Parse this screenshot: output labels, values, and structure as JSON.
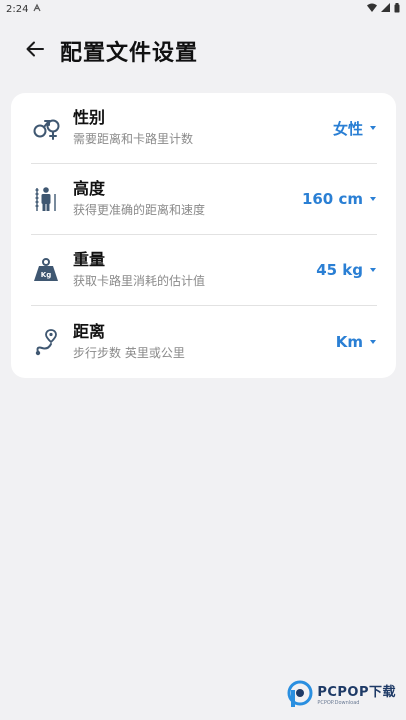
{
  "status_bar": {
    "time": "2:24"
  },
  "header": {
    "title": "配置文件设置"
  },
  "settings": [
    {
      "title": "性别",
      "subtitle": "需要距离和卡路里计数",
      "value": "女性",
      "icon": "gender-icon"
    },
    {
      "title": "高度",
      "subtitle": "获得更准确的距离和速度",
      "value": "160 cm",
      "icon": "height-icon"
    },
    {
      "title": "重量",
      "subtitle": "获取卡路里消耗的估计值",
      "value": "45 kg",
      "icon": "weight-icon"
    },
    {
      "title": "距离",
      "subtitle": "步行步数 英里或公里",
      "value": "Km",
      "icon": "distance-icon"
    }
  ],
  "watermark": {
    "main": "PCPOP下载",
    "sub": "PCPOP.Download"
  },
  "colors": {
    "accent": "#2a7fd4",
    "background": "#f1f1f3",
    "card": "#ffffff",
    "icon": "#3f5771"
  }
}
